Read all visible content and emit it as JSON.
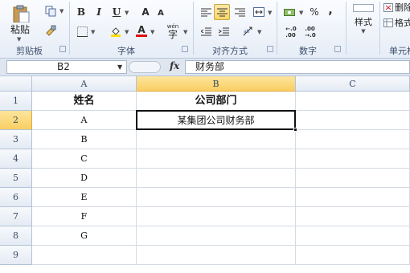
{
  "ribbon": {
    "clipboard": {
      "paste_label": "粘贴",
      "group_label": "剪贴板"
    },
    "font": {
      "group_label": "字体",
      "bold": "B",
      "italic": "I",
      "underline": "U",
      "grow": "A",
      "shrink": "A",
      "color_letter": "A",
      "wen": "wén",
      "zi": "字"
    },
    "align": {
      "group_label": "对齐方式"
    },
    "number": {
      "group_label": "数字",
      "percent": "%",
      "comma": ",",
      "inc_dec": "+.0\n.00",
      "dec_dec": ".00\n+.0"
    },
    "styles": {
      "label": "样式"
    },
    "cells": {
      "delete_label": "删除",
      "format_label": "格式",
      "group_label": "单元格"
    },
    "colors": {
      "highlight": "#ffe000",
      "font_color": "#e01010",
      "ribbon_bg": "#e6edf7"
    }
  },
  "formula_bar": {
    "name_box": "B2",
    "fx": "fx",
    "formula": "财务部"
  },
  "grid": {
    "columns": [
      "A",
      "B",
      "C"
    ],
    "rows": [
      "1",
      "2",
      "3",
      "4",
      "5",
      "6",
      "7",
      "8",
      "9"
    ],
    "cells": {
      "A1": "姓名",
      "B1": "公司部门",
      "A2": "A",
      "B2": "某集团公司财务部",
      "A3": "B",
      "A4": "C",
      "A5": "D",
      "A6": "E",
      "A7": "F",
      "A8": "G"
    },
    "active_cell": "B2"
  }
}
